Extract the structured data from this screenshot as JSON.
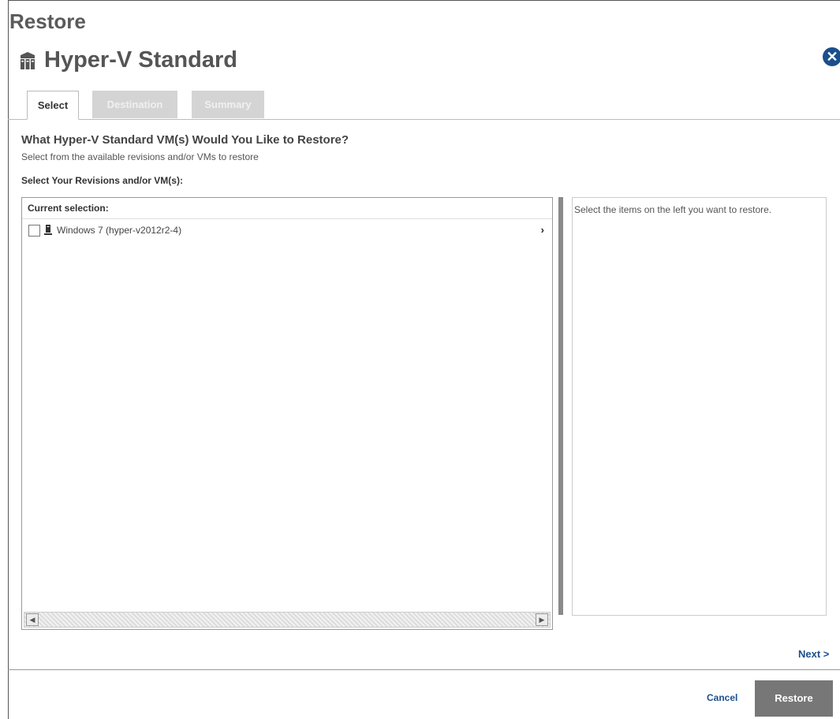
{
  "window": {
    "title": "Restore"
  },
  "header": {
    "vm_title": "Hyper-V Standard",
    "close_symbol": "✕"
  },
  "tabs": [
    {
      "label": "Select"
    },
    {
      "label": "Destination"
    },
    {
      "label": "Summary"
    }
  ],
  "main": {
    "question": "What Hyper-V Standard VM(s) Would You Like to Restore?",
    "subtitle": "Select from the available revisions and/or VMs to restore",
    "select_label": "Select Your Revisions and/or VM(s):",
    "panel_header": "Current selection:",
    "items": [
      {
        "label": "Windows 7 (hyper-v2012r2-4)",
        "expand_symbol": "›"
      }
    ],
    "right_panel_text": "Select the items on the left you want to restore."
  },
  "scrollbar": {
    "left_arrow": "◀",
    "right_arrow": "▶"
  },
  "footer": {
    "next_label": "Next >",
    "cancel_label": "Cancel",
    "restore_label": "Restore"
  },
  "colors": {
    "accent": "#1b4f8c",
    "primary_button": "#777777",
    "inactive_tab": "#d4d4d4"
  },
  "icons": {
    "vm_title_icon": "hyper-v-servers-icon",
    "item_icon": "pc-tower-icon"
  }
}
